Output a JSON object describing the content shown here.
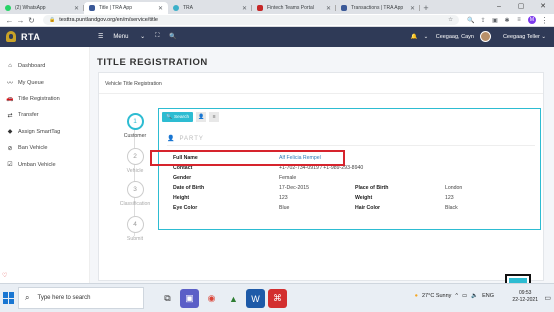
{
  "browser": {
    "tabs": [
      {
        "title": "(2) WhatsApp",
        "icon": "whatsapp-icon",
        "color": "#25d366"
      },
      {
        "title": "Title | TRA App",
        "icon": "tra-icon",
        "color": "#3b5998"
      },
      {
        "title": "TRA",
        "icon": "tra-icon",
        "color": "#3bb0c9"
      },
      {
        "title": "Fintech Teams Portal",
        "icon": "teams-icon",
        "color": "#c62828"
      },
      {
        "title": "Transactions | TRA App",
        "icon": "tra-icon",
        "color": "#3b5998"
      }
    ],
    "active_tab": 1,
    "url": "testtra.puntlandgov.org/en/m/service/title"
  },
  "app": {
    "brand": "RTA",
    "menu_label": "Menu",
    "user_name": "Ceegaag, Cayn",
    "role_label": "Ceegaag Teller"
  },
  "sidebar": {
    "items": [
      {
        "label": "Dashboard",
        "icon": "home-icon"
      },
      {
        "label": "My Queue",
        "icon": "chart-icon"
      },
      {
        "label": "Title Registration",
        "icon": "car-icon"
      },
      {
        "label": "Transfer",
        "icon": "transfer-icon"
      },
      {
        "label": "Assign SmartTag",
        "icon": "tag-icon"
      },
      {
        "label": "Ban Vehicle",
        "icon": "ban-icon"
      },
      {
        "label": "Umban Vehicle",
        "icon": "check-icon"
      }
    ]
  },
  "page": {
    "title": "TITLE REGISTRATION",
    "card_header": "Vehicle Title Registration"
  },
  "stepper": [
    {
      "num": "1",
      "label": "Customer"
    },
    {
      "num": "2",
      "label": "Vehicle"
    },
    {
      "num": "3",
      "label": "Classification"
    },
    {
      "num": "4",
      "label": "Submit"
    }
  ],
  "panel": {
    "search_label": "Search",
    "section_title": "PARTY",
    "fields": {
      "full_name_label": "Full Name",
      "full_name": "Alf Felicia Rempel",
      "contact_label": "Contact",
      "contact": "+1-702-734-0919 / +1-989-293-8940",
      "gender_label": "Gender",
      "gender": "Female",
      "dob_label": "Date of Birth",
      "dob": "17-Dec-2015",
      "pob_label": "Place of Birth",
      "pob": "London",
      "height_label": "Height",
      "height": "123",
      "weight_label": "Weight",
      "weight": "123",
      "eye_label": "Eye Color",
      "eye": "Blue",
      "hair_label": "Hair Color",
      "hair": "Black"
    },
    "next_label": "Next"
  },
  "taskbar": {
    "search_placeholder": "Type here to search",
    "weather": "27°C  Sunny",
    "lang": "ENG",
    "time": "09:53",
    "date": "22-12-2021"
  },
  "colors": {
    "accent": "#2dbcd2",
    "header": "#2f3a57",
    "highlight": "#d6242d"
  }
}
